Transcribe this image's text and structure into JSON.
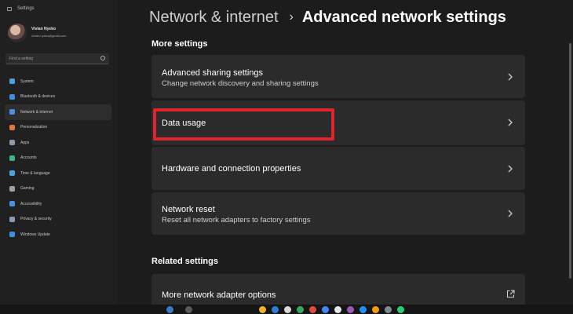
{
  "window": {
    "app_title": "Settings"
  },
  "user": {
    "name": "Vivian Nyeko",
    "email": "vivian.nyeko@gmail.com"
  },
  "search": {
    "placeholder": "Find a setting"
  },
  "sidebar": {
    "items": [
      {
        "label": "System",
        "icon": "system-icon",
        "color": "#4aa3df"
      },
      {
        "label": "Bluetooth & devices",
        "icon": "bluetooth-icon",
        "color": "#3f8ee0"
      },
      {
        "label": "Network & internet",
        "icon": "wifi-icon",
        "color": "#4a90e2",
        "active": true
      },
      {
        "label": "Personalization",
        "icon": "brush-icon",
        "color": "#e0783f"
      },
      {
        "label": "Apps",
        "icon": "apps-icon",
        "color": "#8a9bb0"
      },
      {
        "label": "Accounts",
        "icon": "person-icon",
        "color": "#3fb58f"
      },
      {
        "label": "Time & language",
        "icon": "globe-clock-icon",
        "color": "#4aa3df"
      },
      {
        "label": "Gaming",
        "icon": "gamepad-icon",
        "color": "#9aa3ad"
      },
      {
        "label": "Accessibility",
        "icon": "accessibility-icon",
        "color": "#4a90e2"
      },
      {
        "label": "Privacy & security",
        "icon": "shield-icon",
        "color": "#8a9bb0"
      },
      {
        "label": "Windows Update",
        "icon": "update-icon",
        "color": "#3f8ee0"
      }
    ]
  },
  "header": {
    "parent": "Network & internet",
    "separator": "›",
    "current": "Advanced network settings"
  },
  "more_settings": {
    "label": "More settings",
    "cards": [
      {
        "title": "Advanced sharing settings",
        "description": "Change network discovery and sharing settings"
      },
      {
        "title": "Data usage",
        "description": ""
      },
      {
        "title": "Hardware and connection properties",
        "description": ""
      },
      {
        "title": "Network reset",
        "description": "Reset all network adapters to factory settings"
      }
    ]
  },
  "related_settings": {
    "label": "Related settings",
    "cards": [
      {
        "title": "More network adapter options"
      }
    ]
  },
  "colors": {
    "highlight": "#e0242b",
    "accent": "#4a90e2"
  }
}
